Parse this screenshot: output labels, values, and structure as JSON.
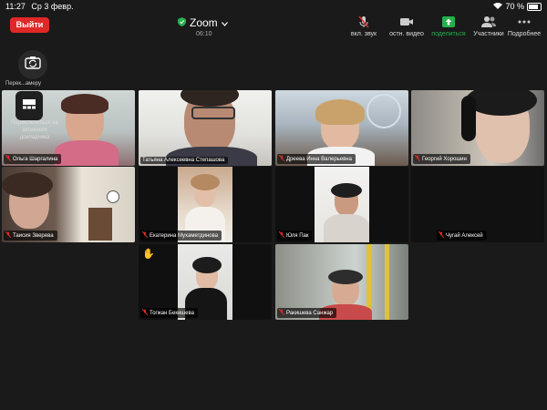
{
  "status_bar": {
    "time": "11:27",
    "date": "Ср 3 февр.",
    "battery": "70 %"
  },
  "header": {
    "leave_label": "Выйти",
    "title": "Zoom",
    "timer": "06:10"
  },
  "toolbar": {
    "mute_label": "вкл. звук",
    "video_label": "остн. видео",
    "share_label": "поделиться",
    "participants_label": "Участники",
    "more_label": "Подробнее"
  },
  "camera": {
    "switch_label": "Перек...амеру"
  },
  "overlay": {
    "text": "Переключиться на активного докладчика"
  },
  "participants": [
    {
      "name": "Ольга Шаргалина"
    },
    {
      "name": "Татьяна Алексеевна Степашова"
    },
    {
      "name": "Дреева Инна Валерьевна"
    },
    {
      "name": "Георгий Хорошин"
    },
    {
      "name": "Таисия Зверева"
    },
    {
      "name": "Екатерина Мухаметдинова"
    },
    {
      "name": "Юля Пак"
    },
    {
      "name": "Чугай Алексей"
    },
    {
      "name": "Тогжан Бекишева"
    },
    {
      "name": "Ракишева Санжар"
    }
  ],
  "colors": {
    "leave": "#e02828",
    "share": "#23b14d",
    "active_speaker": "#23b14d",
    "muted": "#e02828"
  }
}
